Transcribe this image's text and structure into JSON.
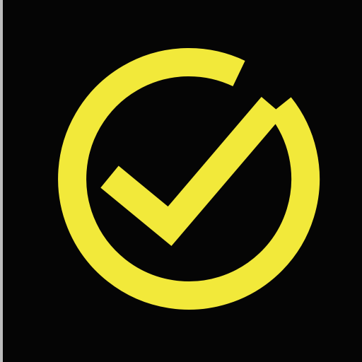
{
  "app_icon": {
    "name": "check-circle-icon",
    "accent_color": "#F2E93A",
    "background_color": "#050505",
    "edge_color": "#BDBDBD"
  }
}
